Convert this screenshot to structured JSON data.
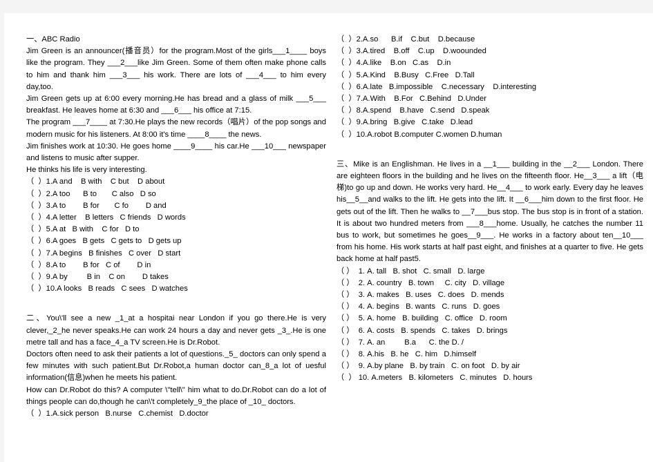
{
  "document": {
    "type": "english-cloze-worksheet",
    "background_color": "#f4f4f4",
    "page_color": "#ffffff",
    "text_color": "#000000"
  },
  "left_column": {
    "section_one": {
      "heading": "一、ABC Radio",
      "paragraphs": [
        "Jim Green is an announcer(播音员）for the program.Most of the girls___1____ boys like the program. They ___2___like Jim Green. Some of them often make phone calls to him and thank him ___3___ his work. There are lots of ___4___ to him every day,too.",
        "Jim Green gets up at 6:00 every morning.He has bread and a glass of milk ___5___ breakfast. He leaves home at 6:30 and ___6___ his office at 7:15.",
        "The program ___7____ at 7:30.He plays the new records（唱片）of the pop songs and modern music for his listeners. At 8:00 it's time ____8____ the news.",
        "Jim finishes work at 10:30. He goes home ____9____ his car.He ___10___ newspaper and listens to music after supper.",
        "He thinks his life is very interesting."
      ],
      "options": [
        "（  ）1.A and    B with    C but    D about",
        "（  ）2.A too      B to       C also   D so",
        "（  ）3.A to        B for       C fo        D and",
        "（  ）4.A letter    B letters   C friends   D words",
        "（  ）5.A at   B with    C for   D to",
        "（  ）6.A goes   B gets   C gets to   D gets up",
        "（  ）7.A begins   B finishes   C over   D start",
        "（  ）8.A to        B for   C of        D in",
        "（  ）9.A by         B in    C on        D takes",
        "（  ）10.A looks   B reads   C sees   D watches"
      ]
    },
    "section_two": {
      "paragraphs": [
        "二、You\\'ll see a new _1_at a hospitai near London if you go there.He is very clever,_2_he never speaks.He can work 24 hours a day and never gets _3_.He is one metre tall and has a face_4_a TV screen.He is Dr.Robot.",
        "Doctors often need to ask their patients a lot of questions._5_ doctors can only spend a few minutes with such patient.But Dr.Robot,a human doctor can_8_a lot of uesful information(信息)when he meets his patient.",
        "How can Dr.Robot do this? A computer \\\"tell\\\" him what to do.Dr.Robot can do a lot of things people can do,though he can\\'t completely_9_the place of _10_ doctors."
      ],
      "options": [
        "（  ）1.A.sick person   B.nurse   C.chemist   D.doctor"
      ]
    }
  },
  "right_column": {
    "section_two_options_continued": [
      "（  ）2.A.so      B.if    C.but    D.because",
      "（  ）3.A.tired    B.off    C.up    D.woounded",
      "（  ）4.A.like    B.on   C.as    D.in",
      "（  ）5.A.Kind    B.Busy   C.Free   D.Tall",
      "（  ）6.A.late   B.impossible    C.necessary    D.interesting",
      "（  ）7.A.With    B.For   C.Behind   D.Under",
      "（  ）8.A.spend    B.have   C.send   D.speak",
      "（  ）9.A.bring   B.give   C.take   D.lead",
      "（  ）10.A.robot B.computer C.women D.human"
    ],
    "section_three": {
      "paragraphs": [
        "三、Mike is an Englishman. He lives in a __1___ building in the __2___ London. There are eighteen floors in the building and he lives on the fifteenth floor. He__3___ a lift（电梯)to go up and down. He works very hard. He__4___ to work early. Every day he leaves his__5__and walks to the lift. He gets into the lift. It __6___him down to the first floor. He gets out of the lift. Then he walks to __7___bus stop. The bus stop is in front of a station. It is about two hundred meters from ___8___home. Usually, he catches the number 11 bus to work, but sometimes he goes__9___. He works in a factory about ten__10___ from his home. His work starts at half past eight, and finishes at a quarter to five. He gets back home at half past5."
      ],
      "options": [
        "（ ）  1. A. tall   B. shot   C. small   D. large",
        "（ ）  2. A. country   B. town     C. city   D. village",
        "（ ）  3. A. makes   B. uses   C. does   D. mends",
        "（ ）  4. A. begins   B. wants   C. runs   D. goes",
        "（ ）  5. A. home   B. building   C. office   D. room",
        "（ ）  6. A. costs   B. spends   C. takes   D. brings",
        "（ ）  7. A. an         B.a      C. the D. /",
        "（ ）  8. A.his   B. he   C. him   D.himself",
        "（ ）  9. A.by plane   B. by train   C. on foot   D. by air",
        "（  ） 10. A.meters   B. kilometers   C. minutes   D. hours"
      ]
    }
  }
}
